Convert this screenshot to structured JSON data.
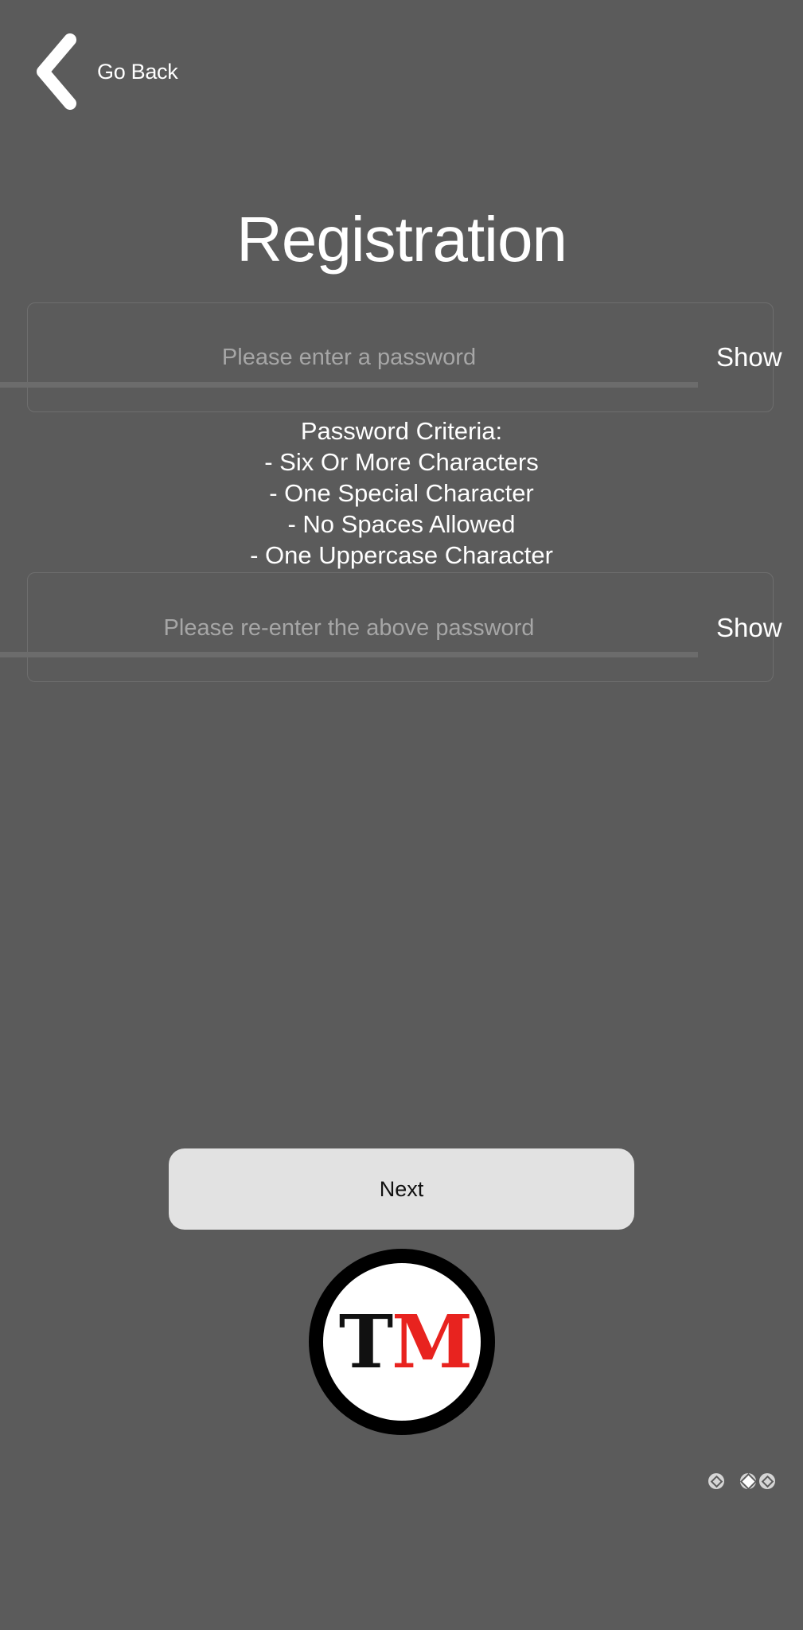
{
  "header": {
    "back_label": "Go Back"
  },
  "page": {
    "title": "Registration"
  },
  "password_field": {
    "placeholder": "Please enter a password",
    "value": "",
    "show_label": "Show"
  },
  "criteria": {
    "heading": "Password Criteria:",
    "items": [
      "- Six Or More Characters",
      "- One Special Character",
      "- No Spaces Allowed",
      "- One Uppercase Character"
    ]
  },
  "confirm_field": {
    "placeholder": "Please re-enter the above password",
    "value": "",
    "show_label": "Show"
  },
  "actions": {
    "next_label": "Next"
  },
  "logo": {
    "letters": [
      "T",
      "M"
    ],
    "colors": {
      "ring": "#000000",
      "letter_t": "#111111",
      "letter_m": "#e8231f"
    }
  },
  "pager": {
    "total": 3,
    "active_index": 1
  },
  "theme": {
    "background": "#5b5b5b",
    "button_bg": "#e2e2e2",
    "text": "#ffffff",
    "placeholder": "#a6a6a6"
  }
}
